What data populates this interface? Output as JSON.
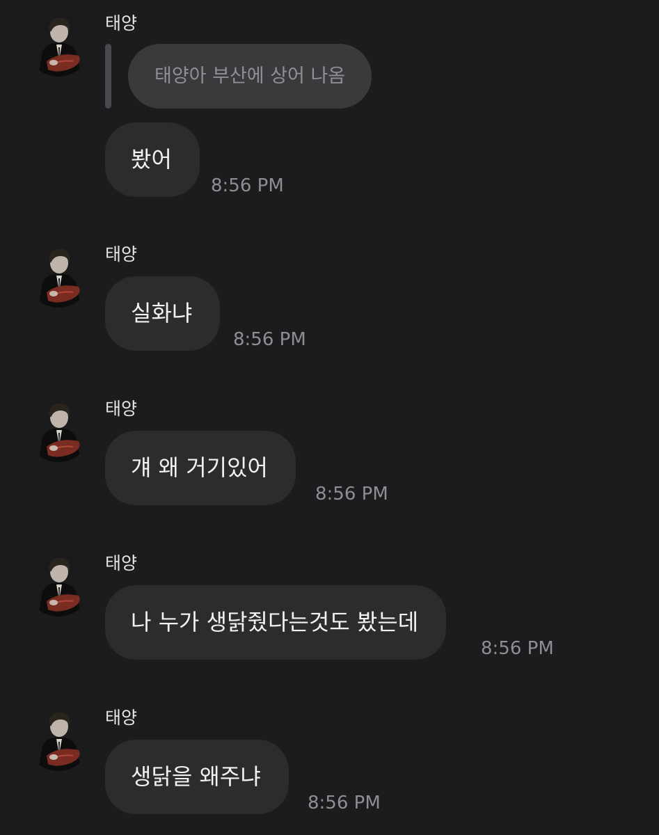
{
  "messages": [
    {
      "sender": "태양",
      "reply_to": "태양아 부산에 상어 나옴",
      "text": "봤어",
      "time": "8:56 PM"
    },
    {
      "sender": "태양",
      "text": "실화냐",
      "time": "8:56 PM"
    },
    {
      "sender": "태양",
      "text": "걔 왜 거기있어",
      "time": "8:56 PM"
    },
    {
      "sender": "태양",
      "text": "나 누가 생닭줬다는것도 봤는데",
      "time": "8:56 PM"
    },
    {
      "sender": "태양",
      "text": "생닭을 왜주냐",
      "time": "8:56 PM"
    }
  ],
  "colors": {
    "background": "#1c1c1e",
    "bubble": "#2c2c2e",
    "reply_bubble": "#3a3a3d",
    "reply_bar": "#4a4a4e",
    "time_text": "#8e8e93"
  },
  "icons": {
    "avatar": "profile-photo"
  }
}
